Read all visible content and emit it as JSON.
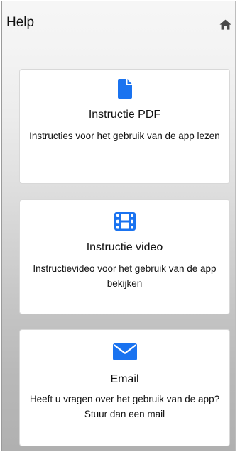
{
  "header": {
    "title": "Help",
    "home_icon": "home-icon"
  },
  "accent_color": "#1a73f0",
  "cards": [
    {
      "id": "pdf",
      "icon": "file-icon",
      "title": "Instructie PDF",
      "description": "Instructies voor het gebruik van de app lezen"
    },
    {
      "id": "video",
      "icon": "film-icon",
      "title": "Instructie video",
      "description": "Instructievideo voor het gebruik van de app bekijken"
    },
    {
      "id": "email",
      "icon": "envelope-icon",
      "title": "Email",
      "description": "Heeft u vragen over het gebruik van de app? Stuur dan een mail"
    }
  ]
}
